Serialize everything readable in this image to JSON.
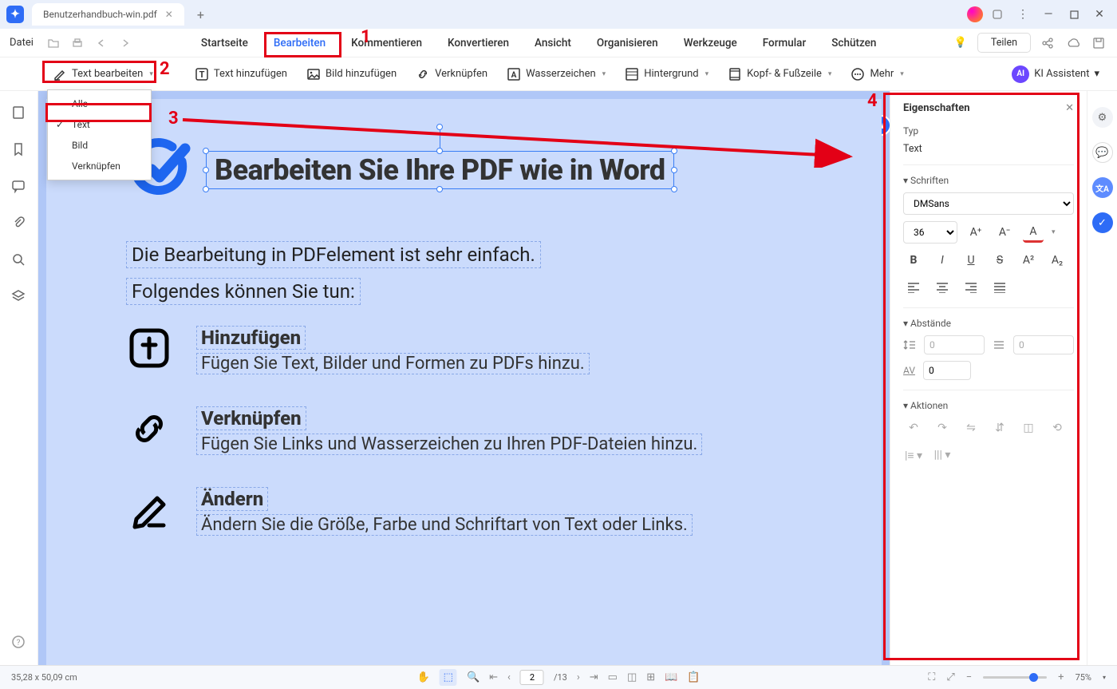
{
  "titlebar": {
    "tab_name": "Benutzerhandbuch-win.pdf"
  },
  "menubar": {
    "file_label": "Datei",
    "tabs": [
      "Startseite",
      "Bearbeiten",
      "Kommentieren",
      "Konvertieren",
      "Ansicht",
      "Organisieren",
      "Werkzeuge",
      "Formular",
      "Schützen"
    ],
    "active_tab_index": 1,
    "share_label": "Teilen"
  },
  "toolbar": {
    "edit_text": "Text bearbeiten",
    "add_text": "Text hinzufügen",
    "add_image": "Bild hinzufügen",
    "link": "Verknüpfen",
    "watermark": "Wasserzeichen",
    "background": "Hintergrund",
    "header_footer": "Kopf- & Fußzeile",
    "more": "Mehr",
    "ki": "KI Assistent"
  },
  "dropdown": {
    "items": [
      "Alle",
      "Text",
      "Bild",
      "Verknüpfen"
    ],
    "checked_index": 1
  },
  "page_content": {
    "title": "Bearbeiten Sie Ihre PDF wie in Word",
    "intro1": "Die Bearbeitung in PDFelement ist sehr einfach.",
    "intro2": "Folgendes können Sie tun:",
    "features": [
      {
        "heading": "Hinzufügen",
        "desc": "Fügen Sie Text, Bilder und Formen zu PDFs hinzu."
      },
      {
        "heading": "Verknüpfen",
        "desc": "Fügen Sie Links und Wasserzeichen zu Ihren PDF-Dateien hinzu."
      },
      {
        "heading": "Ändern",
        "desc": "Ändern Sie die Größe, Farbe und Schriftart von Text oder Links."
      }
    ]
  },
  "right_panel": {
    "title": "Eigenschaften",
    "type_label": "Typ",
    "type_value": "Text",
    "fonts_label": "Schriften",
    "font_name": "DMSans",
    "font_size": "36",
    "spacing_label": "Abstände",
    "spacing_value1": "0",
    "spacing_value2": "0",
    "letter_spacing": "0",
    "actions_label": "Aktionen"
  },
  "statusbar": {
    "coords": "35,28 x 50,09 cm",
    "page_current": "2",
    "page_total": "/13",
    "zoom": "75%"
  },
  "annotations": {
    "n1": "1",
    "n2": "2",
    "n3": "3",
    "n4": "4"
  }
}
